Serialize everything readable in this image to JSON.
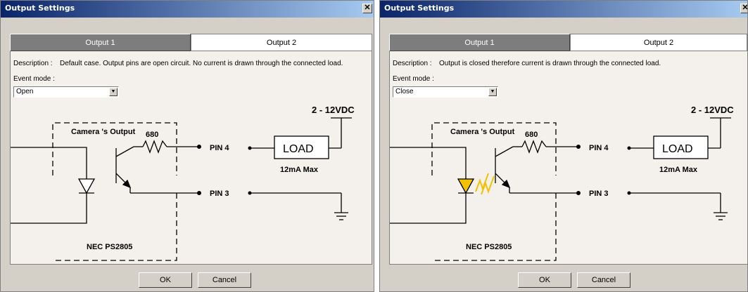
{
  "dialogs": [
    {
      "title": "Output Settings",
      "close_glyph": "✕",
      "tabs": [
        "Output 1",
        "Output 2"
      ],
      "active_tab": "Output 1",
      "description_label": "Description :",
      "description": "Default case. Output pins are open circuit. No current is drawn through the connected load.",
      "event_mode_label": "Event mode :",
      "event_mode_value": "Open",
      "diagram": {
        "camera_label": "Camera 's Output",
        "resistor_label": "680",
        "pin4": "PIN 4",
        "pin3": "PIN 3",
        "load": "LOAD",
        "load_limit": "12mA Max",
        "supply": "2 - 12VDC",
        "chip": "NEC PS2805",
        "led_lit": false
      },
      "ok_label": "OK",
      "cancel_label": "Cancel"
    },
    {
      "title": "Output Settings",
      "close_glyph": "✕",
      "tabs": [
        "Output 1",
        "Output 2"
      ],
      "active_tab": "Output 1",
      "description_label": "Description :",
      "description": "Output is closed therefore current is drawn through the connected load.",
      "event_mode_label": "Event mode :",
      "event_mode_value": "Close",
      "diagram": {
        "camera_label": "Camera 's Output",
        "resistor_label": "680",
        "pin4": "PIN 4",
        "pin3": "PIN 3",
        "load": "LOAD",
        "load_limit": "12mA Max",
        "supply": "2 - 12VDC",
        "chip": "NEC PS2805",
        "led_lit": true
      },
      "ok_label": "OK",
      "cancel_label": "Cancel"
    }
  ],
  "colors": {
    "titlebar": "#0a246a",
    "led_lit": "#f2c200",
    "led_off": "#ffffff"
  }
}
